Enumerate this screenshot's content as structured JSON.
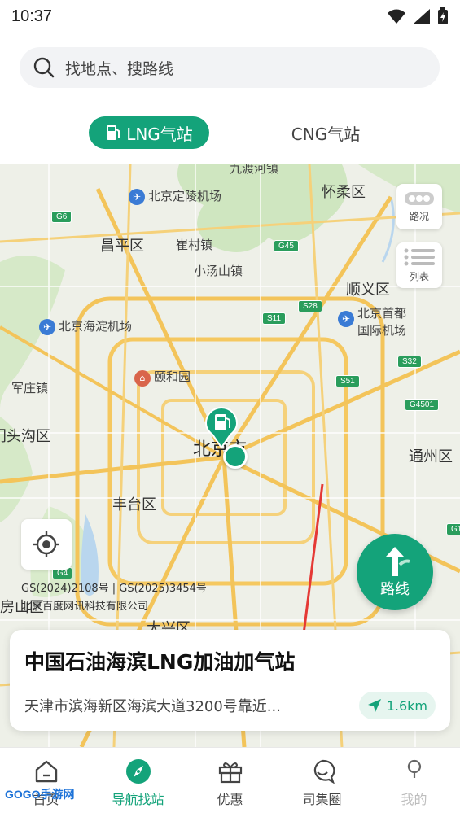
{
  "status": {
    "time": "10:37"
  },
  "search": {
    "placeholder": "找地点、搜路线"
  },
  "tabs": [
    {
      "label": "LNG气站",
      "active": true
    },
    {
      "label": "CNG气站",
      "active": false
    }
  ],
  "map": {
    "labels": {
      "jiuduhe": "九渡河镇",
      "huairou": "怀柔区",
      "dingling_airport": "北京定陵机场",
      "changping": "昌平区",
      "cuicun": "崔村镇",
      "xiaotangshan": "小汤山镇",
      "shunyi": "顺义区",
      "haidian_airport": "北京海淀机场",
      "capital_airport_1": "北京首都",
      "capital_airport_2": "国际机场",
      "yiheyuan": "颐和园",
      "junzhuang": "军庄镇",
      "mentougou": "门头沟区",
      "beijing": "北京市",
      "tongzhou": "通州区",
      "fengtai": "丰台区",
      "fangshan": "房山区",
      "daxing": "大兴区"
    },
    "roads": [
      "G6",
      "G45",
      "S11",
      "S28",
      "S32",
      "S51",
      "G4501",
      "G4",
      "G1"
    ],
    "traffic_button": "路况",
    "list_button": "列表",
    "route_button": "路线",
    "copyright_line1": "GS(2024)2108号 | GS(2025)3454号",
    "copyright_line2": "北京百度网讯科技有限公司"
  },
  "station": {
    "name": "中国石油海滨LNG加油加气站",
    "address": "天津市滨海新区海滨大道3200号靠近...",
    "distance": "1.6km"
  },
  "nav": [
    {
      "label": "首页",
      "icon": "home-icon"
    },
    {
      "label": "导航找站",
      "icon": "compass-icon",
      "active": true
    },
    {
      "label": "优惠",
      "icon": "gift-icon"
    },
    {
      "label": "司集圈",
      "icon": "chat-icon"
    },
    {
      "label": "我的",
      "icon": "user-icon"
    }
  ],
  "watermark": "GOGO手游网",
  "colors": {
    "accent": "#14a37a",
    "annotation_arrow": "#e53935"
  }
}
